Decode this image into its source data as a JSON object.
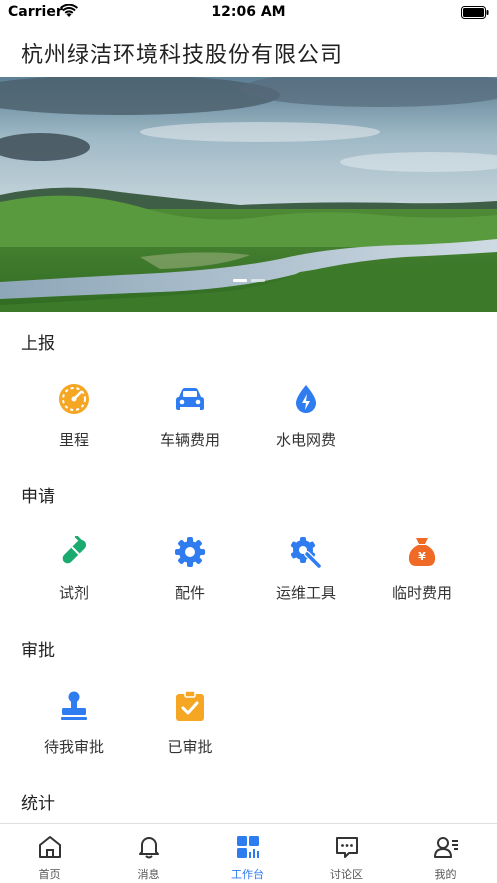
{
  "status_bar": {
    "carrier": "Carrier",
    "time": "12:06 AM"
  },
  "header": {
    "title": "杭州绿洁环境科技股份有限公司"
  },
  "colors": {
    "accent": "#2f7cf0",
    "orange": "#f5a623",
    "green": "#1aaa6e",
    "red_orange": "#f06a26"
  },
  "sections": [
    {
      "title": "上报",
      "items": [
        {
          "label": "里程",
          "icon": "speedometer-icon"
        },
        {
          "label": "车辆费用",
          "icon": "car-icon"
        },
        {
          "label": "水电网费",
          "icon": "water-drop-icon"
        }
      ]
    },
    {
      "title": "申请",
      "items": [
        {
          "label": "试剂",
          "icon": "test-tube-icon"
        },
        {
          "label": "配件",
          "icon": "gear-icon"
        },
        {
          "label": "运维工具",
          "icon": "wrench-gear-icon"
        },
        {
          "label": "临时费用",
          "icon": "money-bag-icon"
        }
      ]
    },
    {
      "title": "审批",
      "items": [
        {
          "label": "待我审批",
          "icon": "stamp-icon"
        },
        {
          "label": "已审批",
          "icon": "approved-clipboard-icon"
        }
      ]
    },
    {
      "title": "统计",
      "items": []
    }
  ],
  "tabs": [
    {
      "label": "首页",
      "icon": "home-icon"
    },
    {
      "label": "消息",
      "icon": "bell-icon"
    },
    {
      "label": "工作台",
      "icon": "workbench-icon"
    },
    {
      "label": "讨论区",
      "icon": "chat-icon"
    },
    {
      "label": "我的",
      "icon": "profile-icon"
    }
  ]
}
